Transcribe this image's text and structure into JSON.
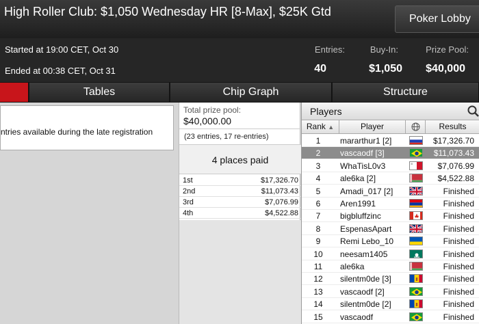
{
  "window": {
    "title": "High Roller Club: $1,050 Wednesday HR [8-Max], $25K Gtd",
    "lobby_button": "Poker Lobby"
  },
  "info": {
    "started": "Started at 19:00 CET, Oct 30",
    "ended": "Ended at 00:38 CET, Oct 31",
    "entries_label": "Entries:",
    "entries_value": "40",
    "buyin_label": "Buy-In:",
    "buyin_value": "$1,050",
    "prizepool_label": "Prize Pool:",
    "prizepool_value": "$40,000"
  },
  "tabs": [
    {
      "label": ""
    },
    {
      "label": "Tables"
    },
    {
      "label": "Chip Graph"
    },
    {
      "label": "Structure"
    }
  ],
  "message": "ntries available during the late registration",
  "prize": {
    "label": "Total prize pool:",
    "amount": "$40,000.00",
    "entries_note": "(23 entries, 17 re-entries)",
    "places_paid": "4 places paid",
    "payouts": [
      {
        "place": "1st",
        "amount": "$17,326.70"
      },
      {
        "place": "2nd",
        "amount": "$11,073.43"
      },
      {
        "place": "3rd",
        "amount": "$7,076.99"
      },
      {
        "place": "4th",
        "amount": "$4,522.88"
      }
    ]
  },
  "players": {
    "title": "Players",
    "columns": {
      "rank": "Rank",
      "player": "Player",
      "results": "Results"
    },
    "rows": [
      {
        "rank": "1",
        "name": "mararthur1 [2]",
        "flag": "russia-flag",
        "result": "$17,326.70"
      },
      {
        "rank": "2",
        "name": "vascaodf [3]",
        "flag": "brazil-flag",
        "result": "$11,073.43"
      },
      {
        "rank": "3",
        "name": "WhaTisL0v3",
        "flag": "malta-flag",
        "result": "$7,076.99"
      },
      {
        "rank": "4",
        "name": "ale6ka [2]",
        "flag": "belarus-flag",
        "result": "$4,522.88"
      },
      {
        "rank": "5",
        "name": "Amadi_017 [2]",
        "flag": "uk-flag",
        "result": "Finished"
      },
      {
        "rank": "6",
        "name": "Aren1991",
        "flag": "armenia-flag",
        "result": "Finished"
      },
      {
        "rank": "7",
        "name": "bigbluffzinc",
        "flag": "canada-flag",
        "result": "Finished"
      },
      {
        "rank": "8",
        "name": "EspenasApart",
        "flag": "uk-flag",
        "result": "Finished"
      },
      {
        "rank": "9",
        "name": "Remi Lebo_10",
        "flag": "ukraine-flag",
        "result": "Finished"
      },
      {
        "rank": "10",
        "name": "neesam1405",
        "flag": "macau-flag",
        "result": "Finished"
      },
      {
        "rank": "11",
        "name": "ale6ka",
        "flag": "belarus-flag",
        "result": "Finished"
      },
      {
        "rank": "12",
        "name": "silentm0de [3]",
        "flag": "moldova-flag",
        "result": "Finished"
      },
      {
        "rank": "13",
        "name": "vascaodf [2]",
        "flag": "brazil-flag",
        "result": "Finished"
      },
      {
        "rank": "14",
        "name": "silentm0de [2]",
        "flag": "moldova-flag",
        "result": "Finished"
      },
      {
        "rank": "15",
        "name": "vascaodf",
        "flag": "brazil-flag",
        "result": "Finished"
      }
    ]
  },
  "colors": {
    "active_tab": "#c8151b",
    "selected_row": "#8c8c8c"
  }
}
